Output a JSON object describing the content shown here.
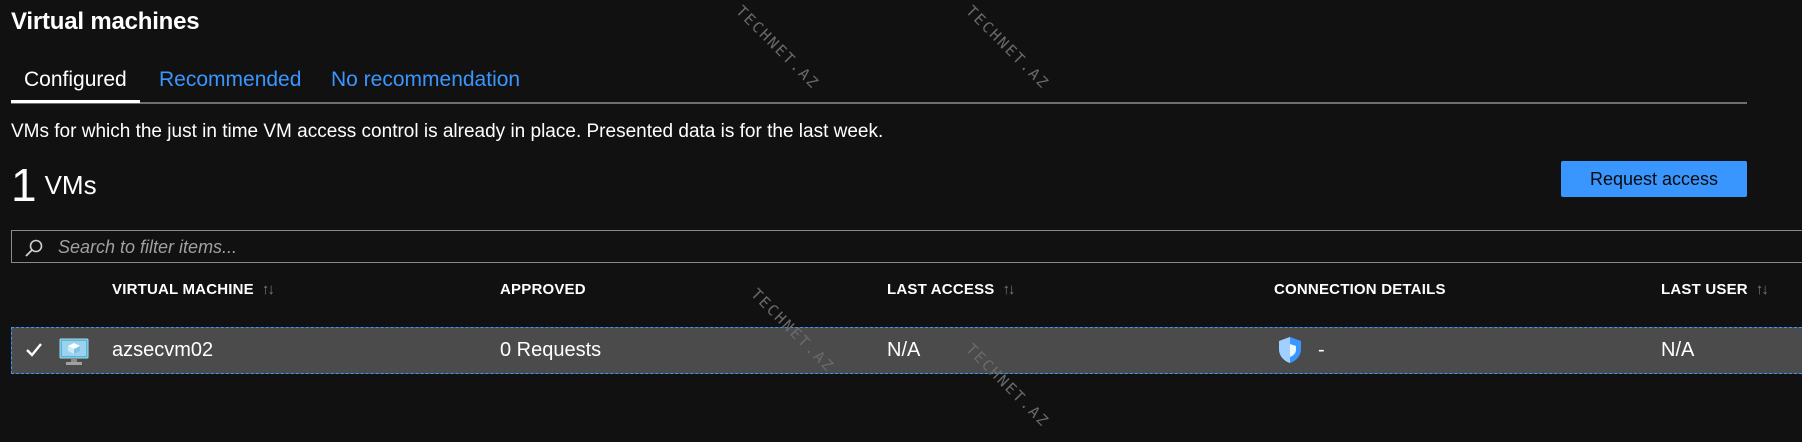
{
  "page": {
    "title": "Virtual machines",
    "description": "VMs for which the just in time VM access control is already in place. Presented data is for the last week."
  },
  "tabs": [
    {
      "label": "Configured",
      "active": true
    },
    {
      "label": "Recommended",
      "active": false
    },
    {
      "label": "No recommendation",
      "active": false
    }
  ],
  "summary": {
    "count": "1",
    "unit": "VMs"
  },
  "actions": {
    "request_access_label": "Request access"
  },
  "search": {
    "placeholder": "Search to filter items...",
    "value": ""
  },
  "table": {
    "columns": [
      {
        "label": "VIRTUAL MACHINE",
        "sortable": true
      },
      {
        "label": "APPROVED",
        "sortable": false
      },
      {
        "label": "LAST ACCESS",
        "sortable": true
      },
      {
        "label": "CONNECTION DETAILS",
        "sortable": false
      },
      {
        "label": "LAST USER",
        "sortable": true
      }
    ],
    "sort_glyph": "↑↓",
    "rows": [
      {
        "selected": true,
        "icon": "virtual-machine-icon",
        "virtual_machine": "azsecvm02",
        "approved": "0 Requests",
        "last_access": "N/A",
        "connection_icon": "shield-icon",
        "connection_details": "-",
        "last_user": "N/A"
      }
    ]
  },
  "watermark": {
    "text": "TECHNET.AZ"
  },
  "colors": {
    "background": "#111111",
    "accent": "#3a96ff",
    "row_selected": "#4b4b4b"
  }
}
